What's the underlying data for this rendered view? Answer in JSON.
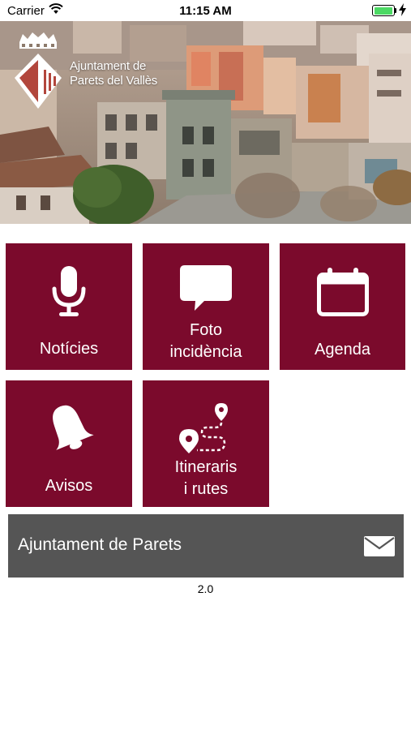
{
  "status_bar": {
    "carrier": "Carrier",
    "time": "11:15 AM",
    "battery_level": 1.0,
    "wifi_icon": "wifi-icon",
    "charging_icon": "charging-bolt-icon"
  },
  "header": {
    "logo_line1": "Ajuntament de",
    "logo_line2": "Parets del Vallès",
    "logo_icon": "municipal-crest-icon"
  },
  "tiles": [
    {
      "line1": "Notícies",
      "line2": "",
      "icon": "microphone-icon"
    },
    {
      "line1": "Foto",
      "line2": "incidència",
      "icon": "speech-bubble-icon"
    },
    {
      "line1": "Agenda",
      "line2": "",
      "icon": "calendar-icon"
    },
    {
      "line1": "Avisos",
      "line2": "",
      "icon": "bell-icon"
    },
    {
      "line1": "Itineraris",
      "line2": "i rutes",
      "icon": "route-map-icon"
    }
  ],
  "contact": {
    "label": "Ajuntament de Parets",
    "icon": "envelope-icon"
  },
  "version": "2.0",
  "colors": {
    "tile_background": "#7b0a2c",
    "contact_background": "#555555",
    "battery_fill": "#4cd964"
  }
}
